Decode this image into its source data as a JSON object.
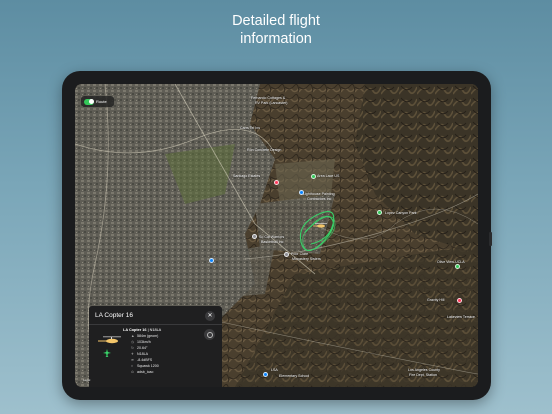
{
  "headline": {
    "line1": "Detailed flight",
    "line2": "information"
  },
  "route_toggle": {
    "label": "Route",
    "enabled": true
  },
  "map": {
    "labels": [
      {
        "id": "fernando-cottages",
        "text": "Fernando Cottages &"
      },
      {
        "id": "rv-park",
        "text": "RV Park (Lancaster)"
      },
      {
        "id": "carrs-tel",
        "text": "Carrs Tel Ins"
      },
      {
        "id": "ron-concrete",
        "text": "Ron Concrete Design"
      },
      {
        "id": "santiago-estates",
        "text": "Santiago Estates"
      },
      {
        "id": "area-lace",
        "text": "Area Lace US"
      },
      {
        "id": "lighthouse",
        "text": "Lighthouse Painting"
      },
      {
        "id": "contractors",
        "text": "Contractors Inc"
      },
      {
        "id": "lopez-canyon",
        "text": "Lopez Canyon Park"
      },
      {
        "id": "so-cal-warriors",
        "text": "So Cal Warriors"
      },
      {
        "id": "basketball",
        "text": "Basketball Inc"
      },
      {
        "id": "poor-clare",
        "text": "Poor Clare"
      },
      {
        "id": "monastery",
        "text": "Monastery Sisters"
      },
      {
        "id": "olive-view",
        "text": "Olive View-UCLA"
      },
      {
        "id": "gravity-hill",
        "text": "Gravity Hill"
      },
      {
        "id": "lakeview-terrace",
        "text": "Lakeview Terrace"
      },
      {
        "id": "la-fire-station",
        "text": "Los Angeles County"
      },
      {
        "id": "fire-station-sub",
        "text": "Fire Dept. Station"
      },
      {
        "id": "lsa",
        "text": "LSA"
      },
      {
        "id": "elementary",
        "text": "Elementary School"
      }
    ],
    "legal": "Legal"
  },
  "flight_panel": {
    "title": "LA Copter 16",
    "close_icon": "close-icon",
    "callsign": "LA Copter 16",
    "registration": "N18LA",
    "details": [
      {
        "icon": "altitude-icon",
        "glyph": "▲",
        "text": "584m (geom)"
      },
      {
        "icon": "speed-icon",
        "glyph": "◷",
        "text": "103km/h"
      },
      {
        "icon": "heading-icon",
        "glyph": "↻",
        "text": "20.64°"
      },
      {
        "icon": "registration-icon",
        "glyph": "✈",
        "text": "N18LA"
      },
      {
        "icon": "signal-icon",
        "glyph": "≋",
        "text": "-8.4dBFS"
      },
      {
        "icon": "squawk-icon",
        "glyph": "⌗",
        "text": "Squawk 1200"
      },
      {
        "icon": "source-icon",
        "glyph": "⊙",
        "text": "adsb_icao"
      }
    ]
  },
  "colors": {
    "background_top": "#5d8da2",
    "background_bottom": "#9ec0cd",
    "route_line": "#39d66a",
    "aircraft": "#f4c66a",
    "panel_bg": "#1f1f20",
    "toggle_on": "#34c759"
  }
}
